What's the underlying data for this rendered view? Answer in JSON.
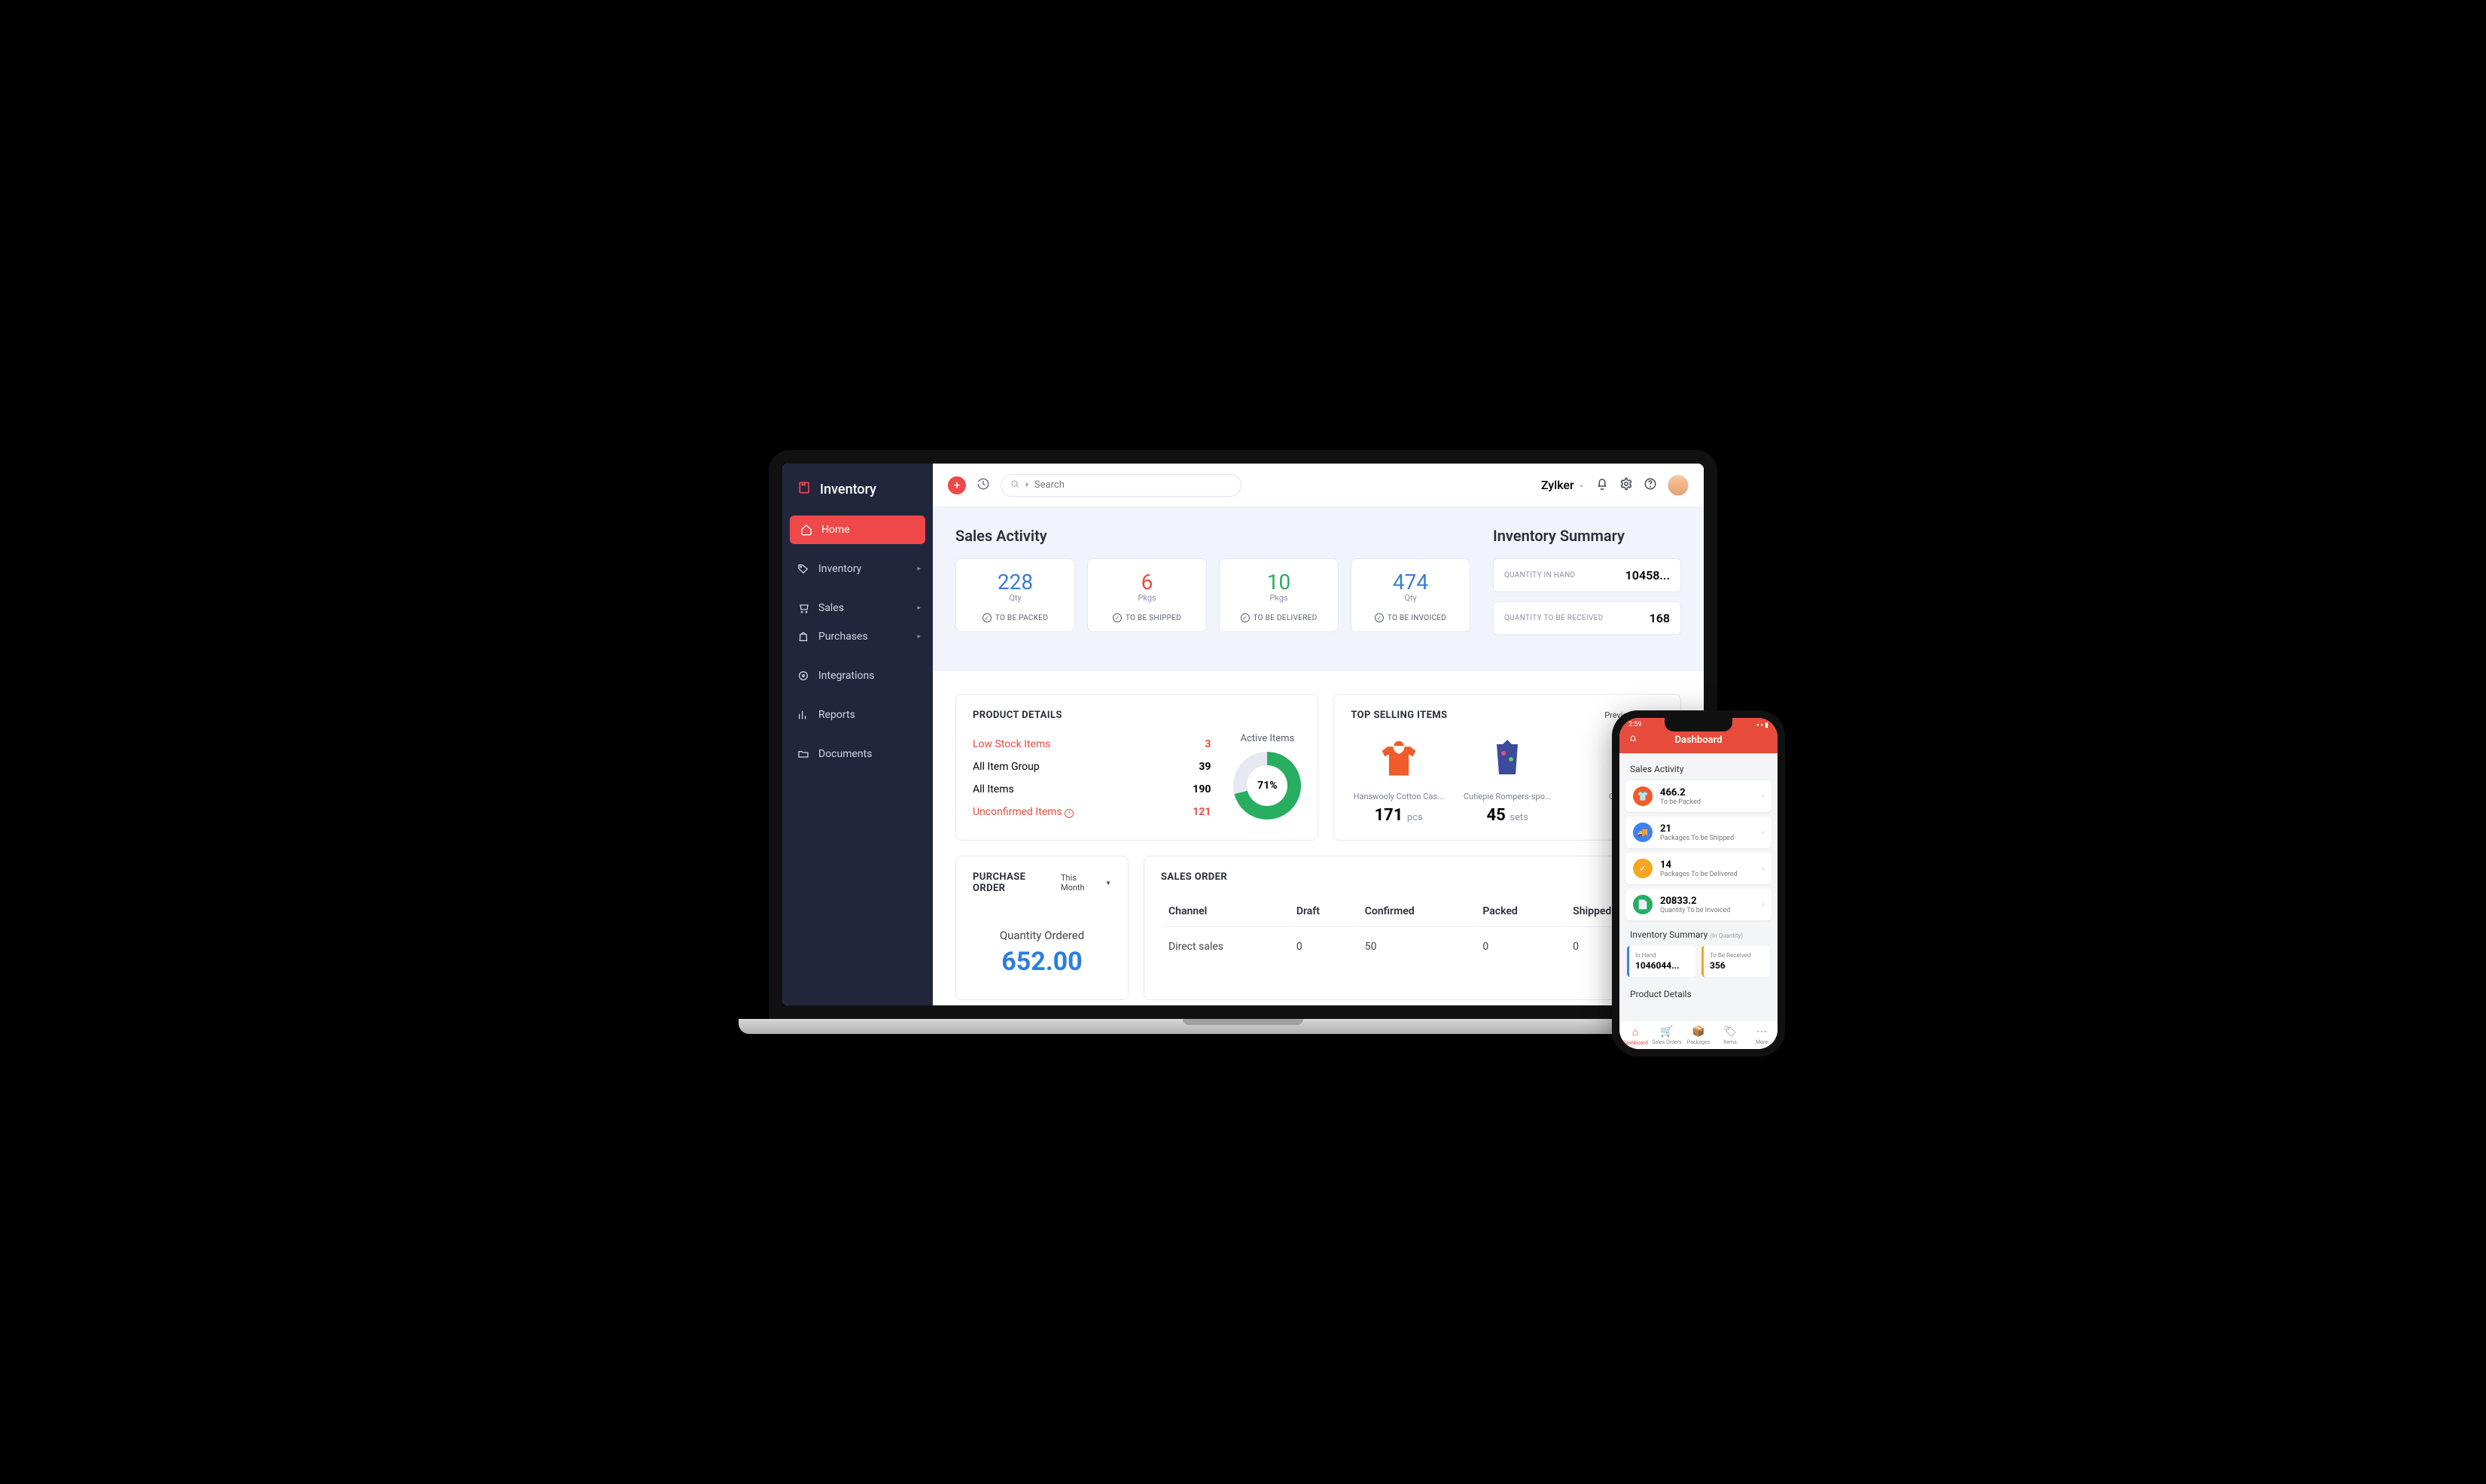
{
  "sidebar": {
    "brand": "Inventory",
    "items": [
      {
        "label": "Home"
      },
      {
        "label": "Inventory"
      },
      {
        "label": "Sales"
      },
      {
        "label": "Purchases"
      },
      {
        "label": "Integrations"
      },
      {
        "label": "Reports"
      },
      {
        "label": "Documents"
      }
    ]
  },
  "topbar": {
    "search_placeholder": "Search",
    "org": "Zylker"
  },
  "sales_activity": {
    "title": "Sales Activity",
    "cards": [
      {
        "value": "228",
        "unit": "Qty",
        "label": "TO BE PACKED",
        "color": "c-blue"
      },
      {
        "value": "6",
        "unit": "Pkgs",
        "label": "TO BE SHIPPED",
        "color": "c-red"
      },
      {
        "value": "10",
        "unit": "Pkgs",
        "label": "TO BE DELIVERED",
        "color": "c-green"
      },
      {
        "value": "474",
        "unit": "Qty",
        "label": "TO BE INVOICED",
        "color": "c-blue"
      }
    ]
  },
  "inventory_summary": {
    "title": "Inventory Summary",
    "rows": [
      {
        "label": "QUANTITY IN HAND",
        "value": "10458..."
      },
      {
        "label": "QUANTITY TO BE RECEIVED",
        "value": "168"
      }
    ]
  },
  "product_details": {
    "title": "PRODUCT DETAILS",
    "rows": [
      {
        "label": "Low Stock Items",
        "value": "3",
        "red": true
      },
      {
        "label": "All Item Group",
        "value": "39"
      },
      {
        "label": "All Items",
        "value": "190"
      },
      {
        "label": "Unconfirmed Items",
        "value": "121",
        "red": true,
        "warn": true
      }
    ],
    "active_label": "Active Items",
    "active_pct": "71%"
  },
  "top_selling": {
    "title": "TOP SELLING ITEMS",
    "period": "Previous Year",
    "items": [
      {
        "name": "Hanswooly Cotton Cas...",
        "qty": "171",
        "unit": "pcs"
      },
      {
        "name": "Cutiepie Rompers-spo...",
        "qty": "45",
        "unit": "sets"
      },
      {
        "name": "Cuti",
        "qty": "",
        "unit": ""
      }
    ]
  },
  "purchase_order": {
    "title": "PURCHASE ORDER",
    "period": "This Month",
    "label": "Quantity Ordered",
    "value": "652.00"
  },
  "sales_order": {
    "title": "SALES ORDER",
    "headers": [
      "Channel",
      "Draft",
      "Confirmed",
      "Packed",
      "Shipped"
    ],
    "row": {
      "channel": "Direct sales",
      "draft": "0",
      "confirmed": "50",
      "packed": "0",
      "shipped": "0"
    }
  },
  "phone": {
    "time": "2:59",
    "header": "Dashboard",
    "sales_title": "Sales Activity",
    "cards": [
      {
        "value": "466.2",
        "sub": "To be Packed",
        "color": "#f15a29"
      },
      {
        "value": "21",
        "sub": "Packages To be Shipped",
        "color": "#3b82f6"
      },
      {
        "value": "14",
        "sub": "Packages To be Delivered",
        "color": "#f5a623"
      },
      {
        "value": "20833.2",
        "sub": "Quantity To be Invoiced",
        "color": "#27ae60"
      }
    ],
    "summary_title": "Inventory Summary",
    "summary_sub": "(In Quantity)",
    "summary": [
      {
        "label": "In Hand",
        "value": "1046044...",
        "border": "#3b82f6"
      },
      {
        "label": "To Be Received",
        "value": "356",
        "border": "#f5a623"
      }
    ],
    "prod_title": "Product Details",
    "tabs": [
      {
        "label": "Dashboard"
      },
      {
        "label": "Sales Orders"
      },
      {
        "label": "Packages"
      },
      {
        "label": "Items"
      },
      {
        "label": "More"
      }
    ]
  }
}
